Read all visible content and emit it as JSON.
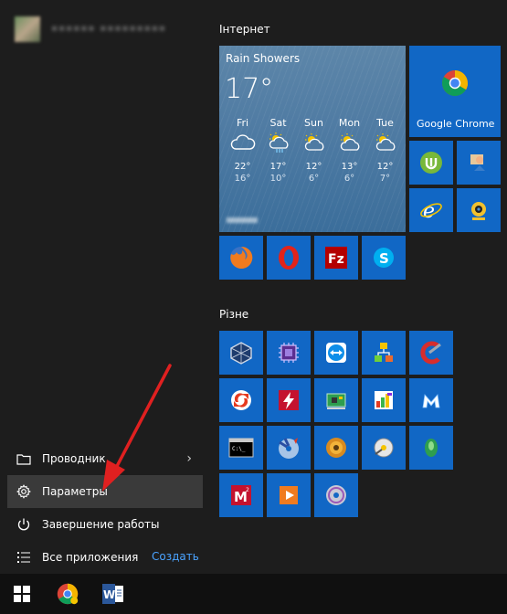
{
  "user": {
    "name": "•••••• •••••••••"
  },
  "left_menu": {
    "explorer": {
      "label": "Проводник",
      "icon": "folder-icon"
    },
    "settings": {
      "label": "Параметры",
      "icon": "gear-icon"
    },
    "shutdown": {
      "label": "Завершение работы",
      "icon": "power-icon"
    },
    "all_apps": {
      "label": "Все приложения",
      "icon": "list-icon"
    },
    "create": {
      "label": "Создать"
    }
  },
  "groups": {
    "internet": {
      "title": "Інтернет"
    },
    "misc": {
      "title": "Різне"
    }
  },
  "weather": {
    "condition": "Rain Showers",
    "temp": "17°",
    "days": [
      {
        "day": "Fri",
        "hi": "22°",
        "lo": "16°"
      },
      {
        "day": "Sat",
        "hi": "17°",
        "lo": "10°"
      },
      {
        "day": "Sun",
        "hi": "12°",
        "lo": "6°"
      },
      {
        "day": "Mon",
        "hi": "13°",
        "lo": "6°"
      },
      {
        "day": "Tue",
        "hi": "12°",
        "lo": "7°"
      }
    ]
  },
  "chrome_tile": {
    "label": "Google Chrome"
  },
  "colors": {
    "tile": "#1167c5",
    "accent_link": "#4aa3ff",
    "arrow": "#e02020"
  },
  "taskbar": {
    "items": [
      "windows-icon",
      "chrome-icon",
      "word-icon"
    ]
  }
}
